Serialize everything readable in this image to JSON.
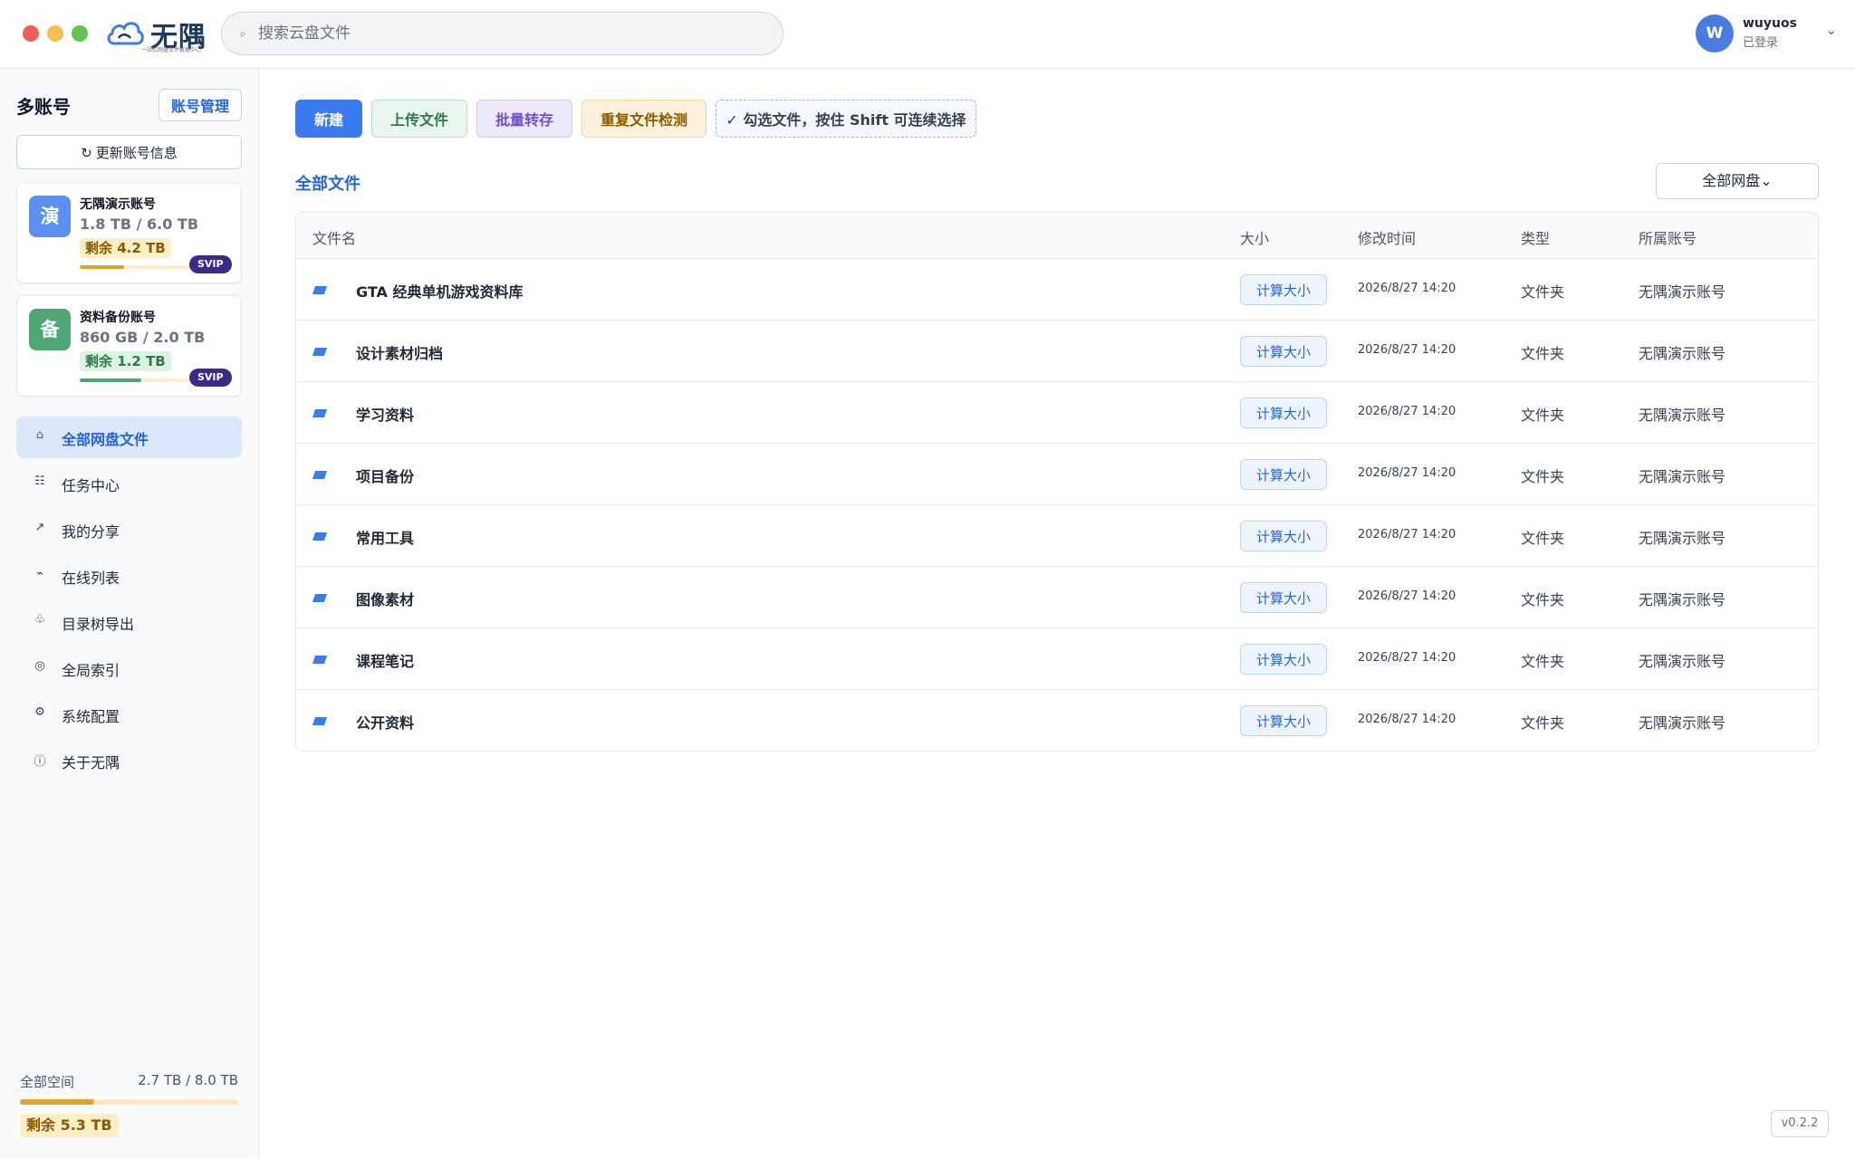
{
  "app": {
    "name": "无隅",
    "tagline": "一站式网盘文件数据中心",
    "colors": {
      "accent": "#3b7bf0",
      "warning": "#e0a42a",
      "success": "#4fa874",
      "svip": "#3b2a8a"
    }
  },
  "search": {
    "placeholder": "搜索云盘文件",
    "value": ""
  },
  "user": {
    "initial": "W",
    "name": "wuyuos",
    "status": "已登录"
  },
  "sidebar": {
    "title": "多账号",
    "manage_label": "账号管理",
    "refresh_label": "更新账号信息",
    "accounts": [
      {
        "avatar_char": "演",
        "name": "无隅演示账号",
        "usage": "1.8 TB / 6.0 TB",
        "remaining": "剩余 4.2 TB",
        "used_fraction": 0.3,
        "badge": "SVIP"
      },
      {
        "avatar_char": "备",
        "name": "资料备份账号",
        "usage": "860 GB / 2.0 TB",
        "remaining": "剩余 1.2 TB",
        "used_fraction": 0.42,
        "badge": "SVIP"
      }
    ],
    "nav": [
      {
        "label": "全部网盘文件",
        "icon": "home-icon",
        "glyph": "⌂",
        "active": true
      },
      {
        "label": "任务中心",
        "icon": "tasks-icon",
        "glyph": "☷",
        "active": false
      },
      {
        "label": "我的分享",
        "icon": "share-icon",
        "glyph": "↗",
        "active": false
      },
      {
        "label": "在线列表",
        "icon": "wifi-icon",
        "glyph": "⌁",
        "active": false
      },
      {
        "label": "目录树导出",
        "icon": "tree-icon",
        "glyph": "♧",
        "active": false
      },
      {
        "label": "全局索引",
        "icon": "index-icon",
        "glyph": "◎",
        "active": false
      },
      {
        "label": "系统配置",
        "icon": "gear-icon",
        "glyph": "⚙",
        "active": false
      },
      {
        "label": "关于无隅",
        "icon": "info-icon",
        "glyph": "ⓘ",
        "active": false
      }
    ],
    "total_space": {
      "label": "全部空间",
      "value": "2.7 TB / 8.0 TB",
      "remaining": "剩余 5.3 TB",
      "used_fraction": 0.34
    }
  },
  "toolbar": {
    "new_label": "新建",
    "upload_label": "上传文件",
    "batch_label": "批量转存",
    "duplicate_label": "重复文件检测",
    "hint_label": "✓ 勾选文件，按住 Shift 可连续选择"
  },
  "main": {
    "section_title": "全部文件",
    "disk_filter": "全部网盘⌄",
    "columns": [
      "文件名",
      "大小",
      "修改时间",
      "类型",
      "所属账号"
    ],
    "calc_label": "计算大小",
    "rows": [
      {
        "name": "GTA 经典单机游戏资料库",
        "time": "2026/8/27 14:20",
        "type": "文件夹",
        "account": "无隅演示账号"
      },
      {
        "name": "设计素材归档",
        "time": "2026/8/27 14:20",
        "type": "文件夹",
        "account": "无隅演示账号"
      },
      {
        "name": "学习资料",
        "time": "2026/8/27 14:20",
        "type": "文件夹",
        "account": "无隅演示账号"
      },
      {
        "name": "项目备份",
        "time": "2026/8/27 14:20",
        "type": "文件夹",
        "account": "无隅演示账号"
      },
      {
        "name": "常用工具",
        "time": "2026/8/27 14:20",
        "type": "文件夹",
        "account": "无隅演示账号"
      },
      {
        "name": "图像素材",
        "time": "2026/8/27 14:20",
        "type": "文件夹",
        "account": "无隅演示账号"
      },
      {
        "name": "课程笔记",
        "time": "2026/8/27 14:20",
        "type": "文件夹",
        "account": "无隅演示账号"
      },
      {
        "name": "公开资料",
        "time": "2026/8/27 14:20",
        "type": "文件夹",
        "account": "无隅演示账号"
      }
    ]
  },
  "version": "v0.2.2"
}
